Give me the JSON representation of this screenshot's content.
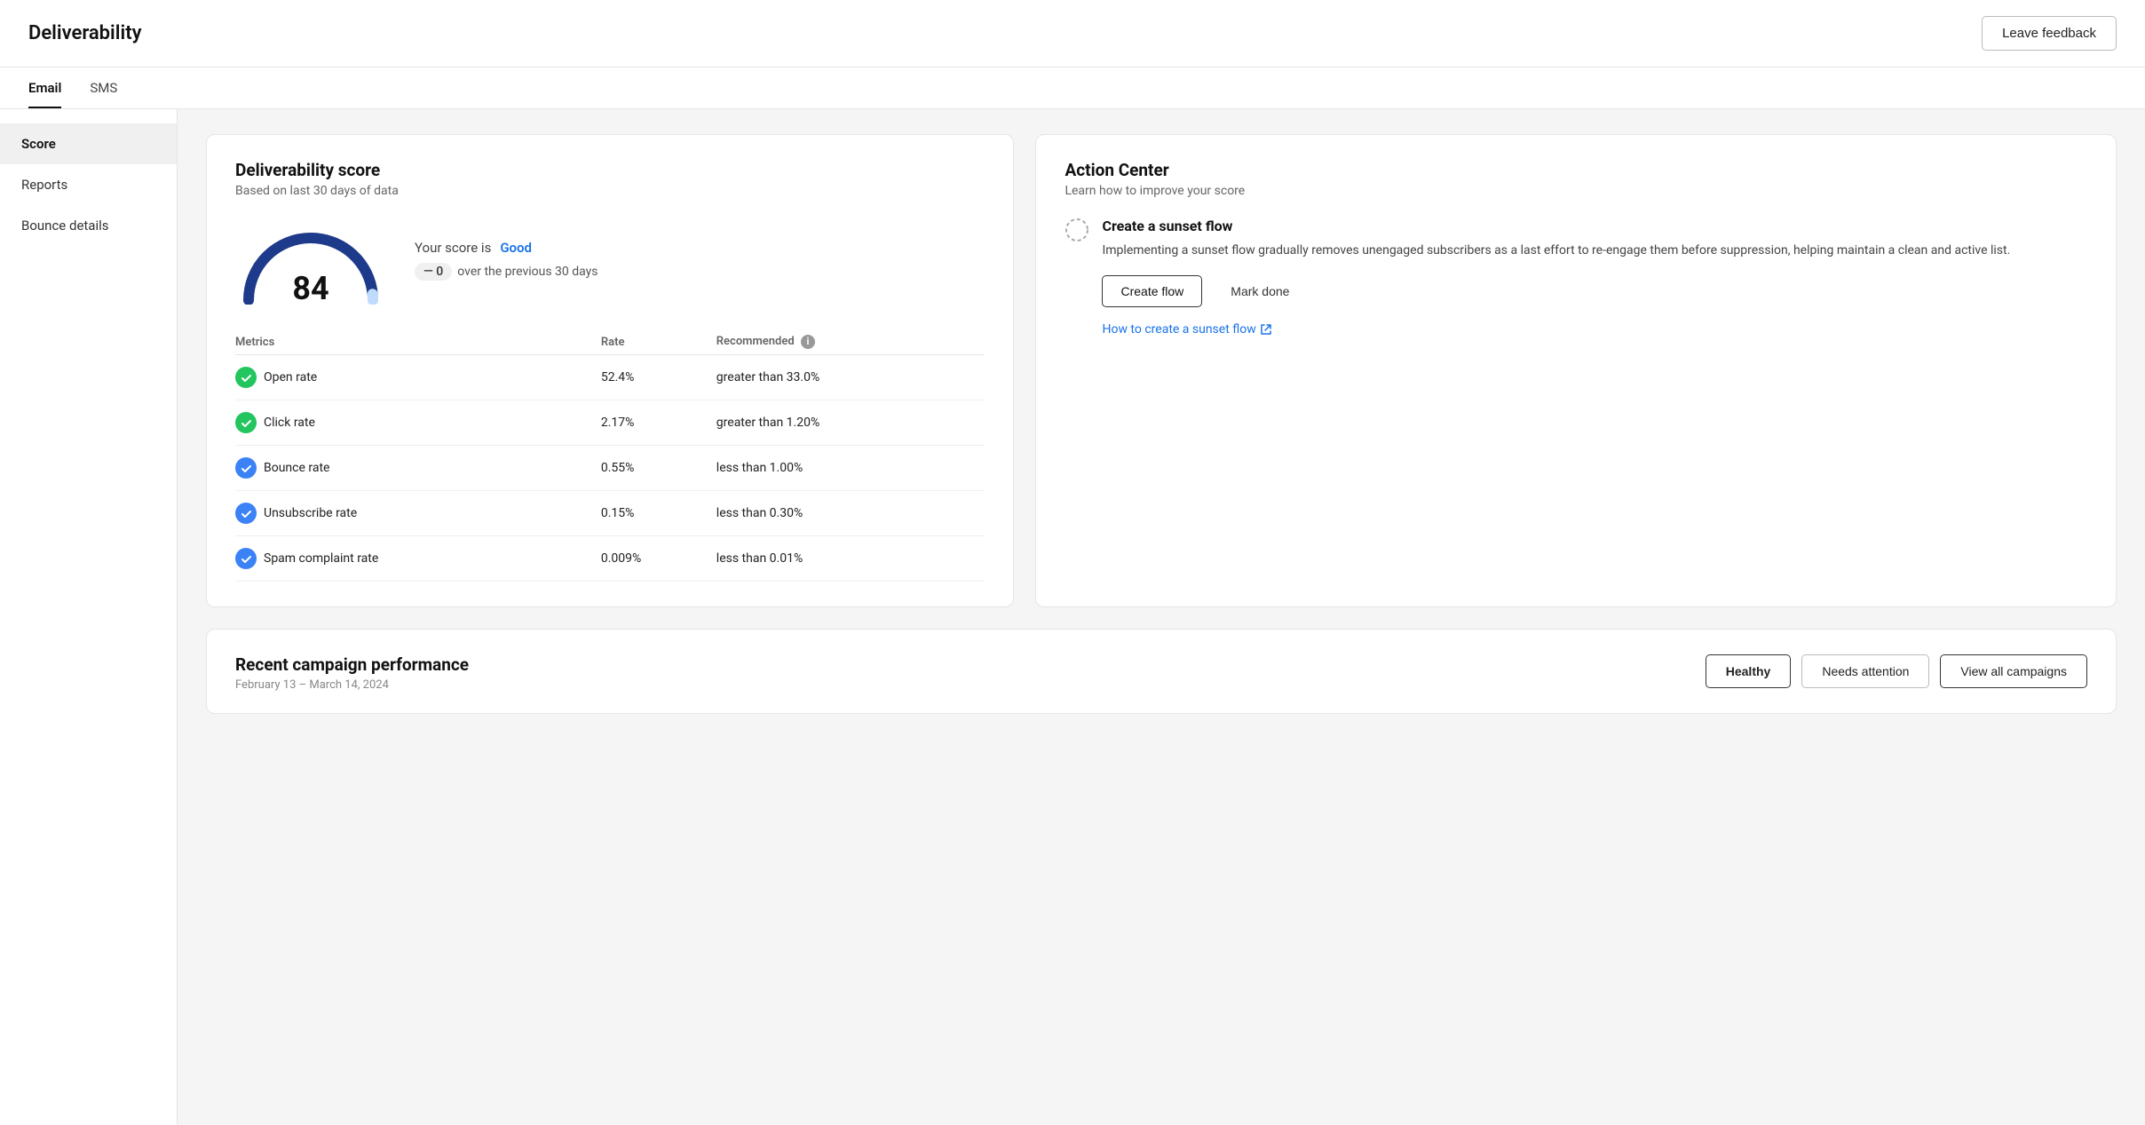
{
  "header": {
    "title": "Deliverability",
    "leave_feedback_label": "Leave feedback"
  },
  "tabs": [
    {
      "id": "email",
      "label": "Email",
      "active": true
    },
    {
      "id": "sms",
      "label": "SMS",
      "active": false
    }
  ],
  "sidebar": {
    "items": [
      {
        "id": "score",
        "label": "Score",
        "active": true
      },
      {
        "id": "reports",
        "label": "Reports",
        "active": false
      },
      {
        "id": "bounce-details",
        "label": "Bounce details",
        "active": false
      }
    ]
  },
  "score_card": {
    "title": "Deliverability score",
    "subtitle": "Based on last 30 days of data",
    "score_value": "84",
    "score_is_label": "Your score is",
    "score_rating": "Good",
    "score_change": "0",
    "score_change_label": "over the previous 30 days",
    "metrics": {
      "header_metric": "Metrics",
      "header_rate": "Rate",
      "header_recommended": "Recommended",
      "rows": [
        {
          "name": "Open rate",
          "rate": "52.4%",
          "recommended": "greater than 33.0%",
          "icon_type": "green-check"
        },
        {
          "name": "Click rate",
          "rate": "2.17%",
          "recommended": "greater than 1.20%",
          "icon_type": "green-check"
        },
        {
          "name": "Bounce rate",
          "rate": "0.55%",
          "recommended": "less than 1.00%",
          "icon_type": "blue-check"
        },
        {
          "name": "Unsubscribe rate",
          "rate": "0.15%",
          "recommended": "less than 0.30%",
          "icon_type": "blue-check"
        },
        {
          "name": "Spam complaint rate",
          "rate": "0.009%",
          "recommended": "less than 0.01%",
          "icon_type": "blue-check"
        }
      ]
    }
  },
  "action_card": {
    "title": "Action Center",
    "subtitle": "Learn how to improve your score",
    "action_title": "Create a sunset flow",
    "action_desc": "Implementing a sunset flow gradually removes unengaged subscribers as a last effort to re-engage them before suppression, helping maintain a clean and active list.",
    "create_flow_label": "Create flow",
    "mark_done_label": "Mark done",
    "link_label": "How to create a sunset flow"
  },
  "recent_campaigns": {
    "title": "Recent campaign performance",
    "subtitle": "February 13 – March 14, 2024",
    "healthy_label": "Healthy",
    "needs_attention_label": "Needs attention",
    "view_all_label": "View all campaigns"
  }
}
